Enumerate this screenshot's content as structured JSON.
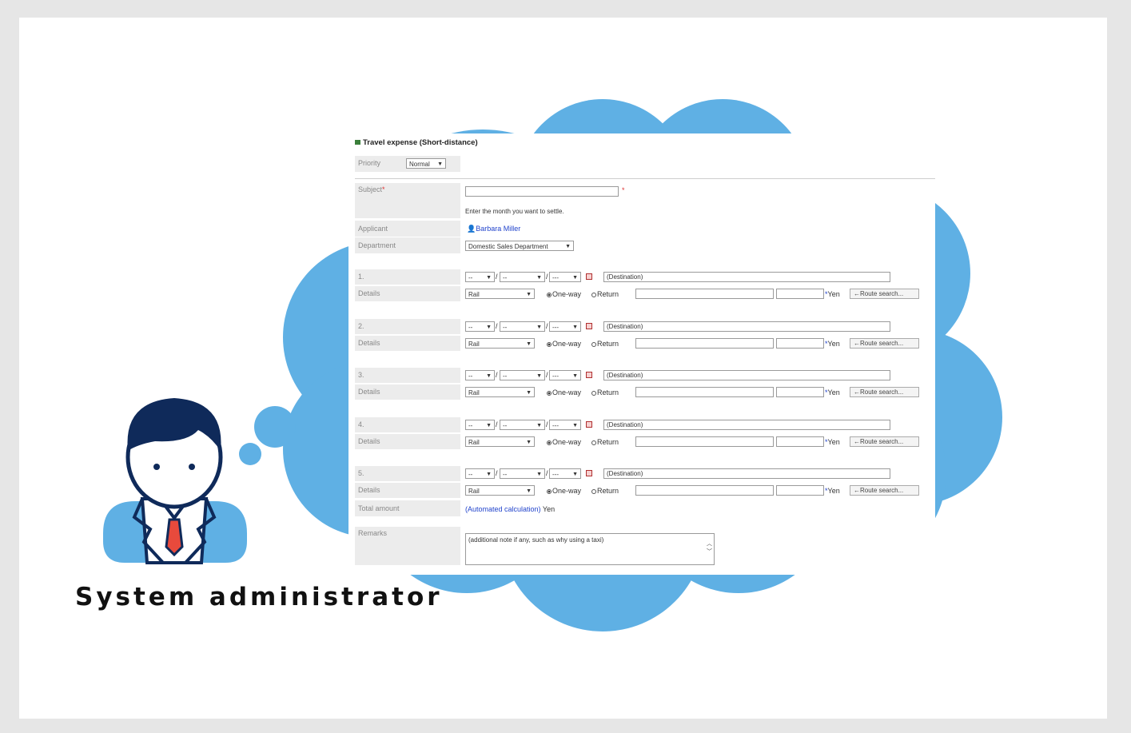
{
  "caption": "System administrator",
  "colors": {
    "cloud": "#5fb0e4",
    "frame": "#e6e6e6",
    "navy": "#0f2a5a",
    "tie": "#e84a3c"
  },
  "form": {
    "title": "Travel expense (Short-distance)",
    "priority": {
      "label": "Priority",
      "value": "Normal"
    },
    "subject": {
      "label": "Subject",
      "required_mark": "*",
      "hint": "Enter the month you want to settle."
    },
    "applicant": {
      "label": "Applicant",
      "value": "Barbara Miller"
    },
    "department": {
      "label": "Department",
      "value": "Domestic Sales Department"
    },
    "routes": [
      {
        "index": "1.",
        "month": "--",
        "day": "--",
        "time": "---",
        "destination": "(Destination)",
        "details_label": "Details",
        "mode": "Rail",
        "oneway": "One-way",
        "return": "Return",
        "currency": "Yen",
        "search": "←Route search..."
      },
      {
        "index": "2.",
        "month": "--",
        "day": "--",
        "time": "---",
        "destination": "(Destination)",
        "details_label": "Details",
        "mode": "Rail",
        "oneway": "One-way",
        "return": "Return",
        "currency": "Yen",
        "search": "←Route search..."
      },
      {
        "index": "3.",
        "month": "--",
        "day": "--",
        "time": "---",
        "destination": "(Destination)",
        "details_label": "Details",
        "mode": "Rail",
        "oneway": "One-way",
        "return": "Return",
        "currency": "Yen",
        "search": "←Route search..."
      },
      {
        "index": "4.",
        "month": "--",
        "day": "--",
        "time": "---",
        "destination": "(Destination)",
        "details_label": "Details",
        "mode": "Rail",
        "oneway": "One-way",
        "return": "Return",
        "currency": "Yen",
        "search": "←Route search..."
      },
      {
        "index": "5.",
        "month": "--",
        "day": "--",
        "time": "---",
        "destination": "(Destination)",
        "details_label": "Details",
        "mode": "Rail",
        "oneway": "One-way",
        "return": "Return",
        "currency": "Yen",
        "search": "←Route search..."
      }
    ],
    "total": {
      "label": "Total amount",
      "value": "(Automated calculation)",
      "currency": "Yen"
    },
    "remarks": {
      "label": "Remarks",
      "value": "(additional note if any, such as why using a taxi)"
    }
  }
}
